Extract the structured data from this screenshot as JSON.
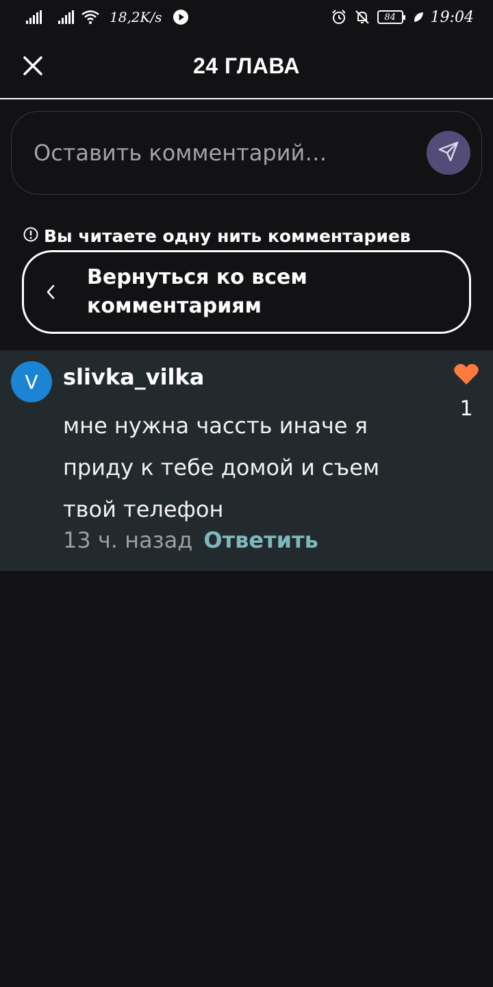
{
  "status_bar": {
    "speed": "18,2K/s",
    "battery": "84",
    "time": "19:04"
  },
  "header": {
    "title": "24 ГЛАВА"
  },
  "comment_input": {
    "placeholder": "Оставить комментарий…"
  },
  "thread": {
    "notice": "Вы читаете одну нить комментариев",
    "back_label": "Вернуться ко всем комментариям"
  },
  "comment": {
    "avatar_letter": "V",
    "username": "slivka_vilka",
    "text": "мне нужна часcть иначе я приду к тебе домой и съем твой телефон",
    "time": "13 ч. назад",
    "reply_label": "Ответить",
    "likes": "1"
  },
  "colors": {
    "background": "#121114",
    "card": "#232a2d",
    "accent": "#7eb7bd",
    "like": "#ff7a3d",
    "avatar": "#1c84d4",
    "send": "#534c79"
  },
  "icons": [
    "signal-icon",
    "wifi-icon",
    "play-icon",
    "alarm-icon",
    "bell-off-icon",
    "battery-icon",
    "leaf-icon",
    "close-icon",
    "send-icon",
    "info-icon",
    "chevron-left-icon",
    "heart-icon"
  ]
}
